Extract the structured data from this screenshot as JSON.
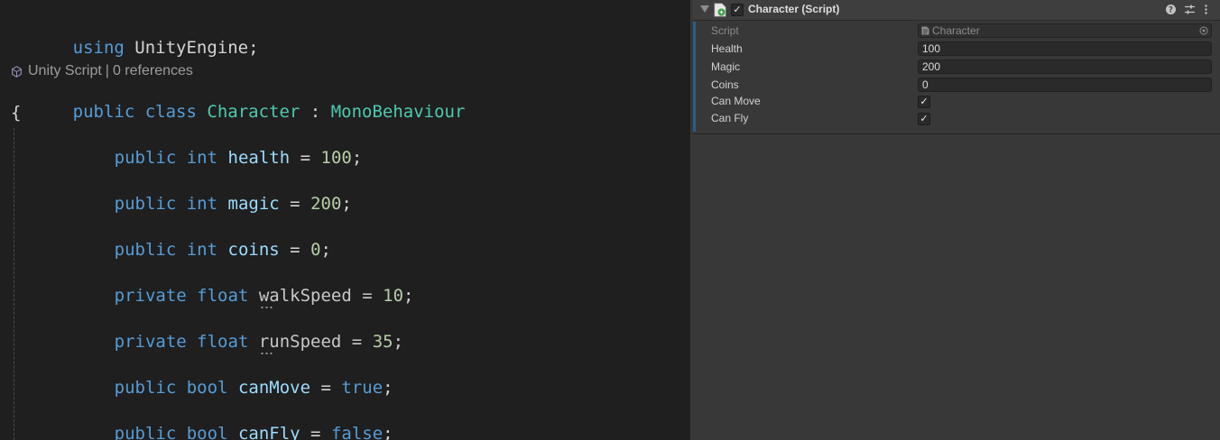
{
  "editor": {
    "using_line": {
      "keyword": "using",
      "namespace": "UnityEngine",
      "semicolon": ";"
    },
    "codelens": {
      "label": "Unity Script",
      "separator": "|",
      "references": "0 references",
      "icon": "unity-cube-icon"
    },
    "class_decl": {
      "kw_public": "public",
      "kw_class": "class",
      "name": "Character",
      "colon": ":",
      "base": "MonoBehaviour"
    },
    "open_brace": "{",
    "fields": [
      {
        "access": "public",
        "type": "int",
        "name": "health",
        "eq": "=",
        "value": "100",
        "end": ";"
      },
      {
        "access": "public",
        "type": "int",
        "name": "magic",
        "eq": "=",
        "value": "200",
        "end": ";"
      },
      {
        "access": "public",
        "type": "int",
        "name": "coins",
        "eq": "=",
        "value": "0",
        "end": ";"
      },
      {
        "access": "private",
        "type": "float",
        "name": "walkSpeed",
        "eq": "=",
        "value": "10",
        "end": ";"
      },
      {
        "access": "private",
        "type": "float",
        "name": "runSpeed",
        "eq": "=",
        "value": "35",
        "end": ";"
      },
      {
        "access": "public",
        "type": "bool",
        "name": "canMove",
        "eq": "=",
        "value": "true",
        "end": ";"
      },
      {
        "access": "public",
        "type": "bool",
        "name": "canFly",
        "eq": "=",
        "value": "false",
        "end": ";"
      }
    ]
  },
  "inspector": {
    "component": {
      "title": "Character (Script)",
      "enabled_mark": "✓",
      "header_icons": [
        "help-icon",
        "presets-icon",
        "more-menu-icon"
      ],
      "properties": {
        "script": {
          "label": "Script",
          "value": "Character"
        },
        "health": {
          "label": "Health",
          "value": "100"
        },
        "magic": {
          "label": "Magic",
          "value": "200"
        },
        "coins": {
          "label": "Coins",
          "value": "0"
        },
        "can_move": {
          "label": "Can Move",
          "mark": "✓"
        },
        "can_fly": {
          "label": "Can Fly",
          "mark": "✓"
        }
      }
    }
  },
  "colors": {
    "keyword": "#569cd6",
    "type": "#4ec9b0",
    "number": "#b5cea8",
    "identifier": "#9cdcfe",
    "editor_bg": "#1f1f1f",
    "inspector_bg": "#383838"
  }
}
